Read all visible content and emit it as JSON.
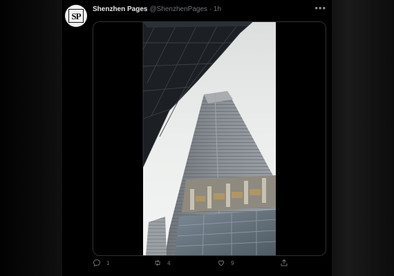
{
  "tweet": {
    "display_name": "Shenzhen Pages",
    "handle": "@ShenzhenPages · 1h",
    "avatar_text": "SP",
    "more_icon": "more-horizontal-icon",
    "media_type": "video-frame",
    "actions": {
      "reply_count": "1",
      "retweet_count": "4",
      "like_count": "9"
    }
  },
  "colors": {
    "background": "#000000",
    "text_primary": "#e7e9ea",
    "text_secondary": "#71767b",
    "border": "#2f3336",
    "sky": "#e9ebea"
  }
}
